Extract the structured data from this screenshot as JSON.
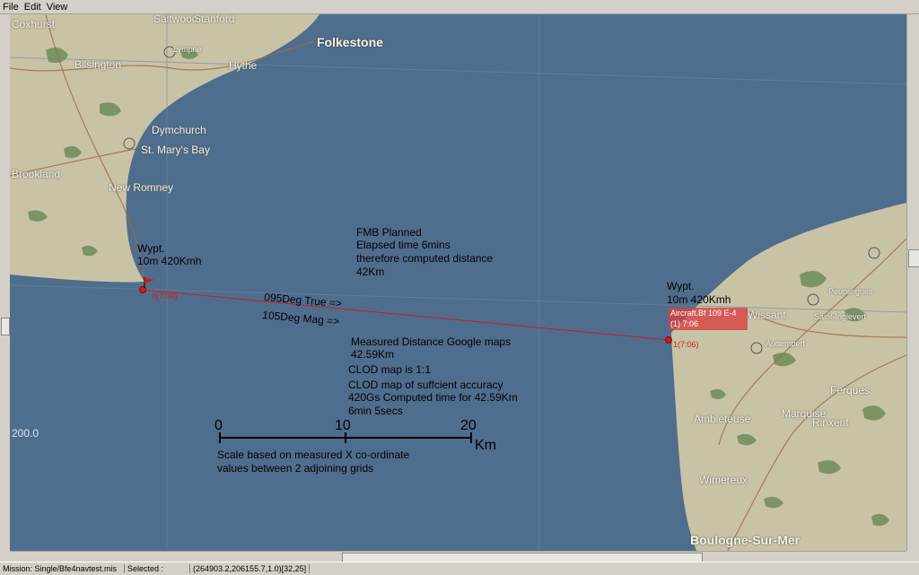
{
  "menu": {
    "file": "File",
    "edit": "Edit",
    "view": "View"
  },
  "places": {
    "coxhurst": "Coxhurst",
    "saltwood": "Saltwood",
    "stanford": "Stanford",
    "folkestone": "Folkestone",
    "bilsington": "Bilsington",
    "lympne": "Lympne",
    "hythe": "Hythe",
    "dymchurch": "Dymchurch",
    "st_marys_bay": "St. Mary's Bay",
    "brookland": "Brookland",
    "new_romney": "New Romney",
    "peuplingues": "Peuplingues",
    "saint_inglevert": "Saint-Inglevert",
    "wissant": "Wissant",
    "audembert": "Audembert",
    "ferques": "Ferques",
    "marquise": "Marquise",
    "rinxent": "Rinxent",
    "ambleteuse": "Ambleteuse",
    "wimereux": "Wimereux",
    "boulogne": "Boulogne-Sur-Mer"
  },
  "grid_label": "200.0",
  "waypoints": {
    "wp0": {
      "title": "Wypt.",
      "detail": "10m 420Kmh",
      "marker": "0(7:00)"
    },
    "wp1": {
      "title": "Wypt.",
      "detail": "10m 420Kmh",
      "marker": "1(7:06)"
    }
  },
  "aircraft_tag": {
    "line1": "Aircraft.Bf 109 E-4",
    "line2": "(1) 7:06"
  },
  "annotations": {
    "fmb": [
      "FMB Planned",
      "Elapsed time 6mins",
      "therefore computed distance",
      "42Km"
    ],
    "true_heading": "095Deg True =>",
    "mag_heading": "105Deg Mag =>",
    "measured": [
      "Measured Distance Google maps",
      "42.59Km",
      "CLOD map is 1:1",
      "CLOD map of suffcient accuracy",
      "420Gs Computed time for 42.59Km",
      "6min 5secs"
    ]
  },
  "scale": {
    "tick0": "0",
    "tick10": "10",
    "tick20": "20",
    "unit": "Km",
    "note": [
      "Scale based on measured X co-ordinate",
      "values between 2 adjoining grids"
    ]
  },
  "status": {
    "mission": "Mission: Single/Bfe4navtest.mis",
    "selected": "Selected :",
    "coords": "(264903.2,206155.7,1.0)[32,25]"
  },
  "colors": {
    "sea": "#4f6e8e",
    "land": "#c9c3a6",
    "forest": "#6f8b5a",
    "route": "#c82020"
  }
}
